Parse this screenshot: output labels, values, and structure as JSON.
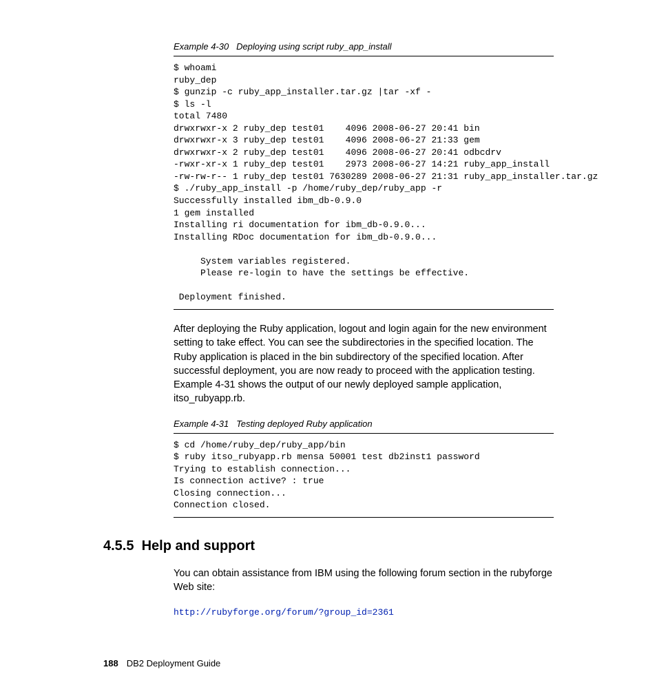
{
  "example1": {
    "caption_label": "Example 4-30",
    "caption_title": "Deploying using script ruby_app_install",
    "code": "$ whoami\nruby_dep\n$ gunzip -c ruby_app_installer.tar.gz |tar -xf -\n$ ls -l\ntotal 7480\ndrwxrwxr-x 2 ruby_dep test01    4096 2008-06-27 20:41 bin\ndrwxrwxr-x 3 ruby_dep test01    4096 2008-06-27 21:33 gem\ndrwxrwxr-x 2 ruby_dep test01    4096 2008-06-27 20:41 odbcdrv\n-rwxr-xr-x 1 ruby_dep test01    2973 2008-06-27 14:21 ruby_app_install\n-rw-rw-r-- 1 ruby_dep test01 7630289 2008-06-27 21:31 ruby_app_installer.tar.gz\n$ ./ruby_app_install -p /home/ruby_dep/ruby_app -r\nSuccessfully installed ibm_db-0.9.0\n1 gem installed\nInstalling ri documentation for ibm_db-0.9.0...\nInstalling RDoc documentation for ibm_db-0.9.0...\n\n     System variables registered.\n     Please re-login to have the settings be effective.\n\n Deployment finished."
  },
  "paragraph1": "After deploying the Ruby application, logout and login again for the new environment setting to take effect. You can see the subdirectories in the specified location. The Ruby application is placed in the bin subdirectory of the specified location. After successful deployment, you are now ready to proceed with the application testing. Example 4-31 shows the output of our newly deployed sample application, itso_rubyapp.rb.",
  "example2": {
    "caption_label": "Example 4-31",
    "caption_title": "Testing deployed Ruby application",
    "code": "$ cd /home/ruby_dep/ruby_app/bin\n$ ruby itso_rubyapp.rb mensa 50001 test db2inst1 password\nTrying to establish connection...\nIs connection active? : true\nClosing connection...\nConnection closed."
  },
  "section": {
    "number": "4.5.5",
    "title": "Help and support"
  },
  "paragraph2": "You can obtain assistance from IBM using the following forum section in the rubyforge Web site:",
  "link": "http://rubyforge.org/forum/?group_id=2361",
  "footer": {
    "page_number": "188",
    "book_title": "DB2 Deployment Guide"
  }
}
